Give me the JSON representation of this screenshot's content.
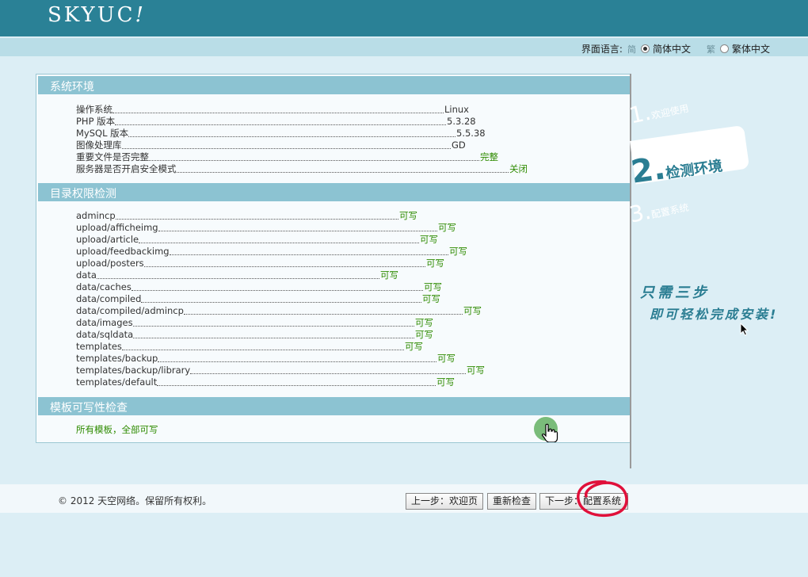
{
  "header": {
    "logo": "SKYUC",
    "logo_mark": "!"
  },
  "language": {
    "label": "界面语言:",
    "simplified_icon": "简",
    "simplified": "简体中文",
    "traditional_icon": "繁",
    "traditional": "繁体中文",
    "selected": "简体中文"
  },
  "env": {
    "title": "系统环境",
    "rows": [
      {
        "label": "操作系统",
        "value": "Linux"
      },
      {
        "label": "PHP 版本",
        "value": "5.3.28"
      },
      {
        "label": "MySQL 版本",
        "value": "5.5.38"
      },
      {
        "label": "图像处理库",
        "value": "GD"
      },
      {
        "label": "重要文件是否完整",
        "value": "完整"
      },
      {
        "label": "服务器是否开启安全模式",
        "value": "关闭"
      }
    ]
  },
  "dirs": {
    "title": "目录权限检测",
    "rows": [
      {
        "label": "admincp",
        "value": "可写"
      },
      {
        "label": "upload/afficheimg",
        "value": "可写"
      },
      {
        "label": "upload/article",
        "value": "可写"
      },
      {
        "label": "upload/feedbackimg",
        "value": "可写"
      },
      {
        "label": "upload/posters",
        "value": "可写"
      },
      {
        "label": "data",
        "value": "可写"
      },
      {
        "label": "data/caches",
        "value": "可写"
      },
      {
        "label": "data/compiled",
        "value": "可写"
      },
      {
        "label": "data/compiled/admincp",
        "value": "可写"
      },
      {
        "label": "data/images",
        "value": "可写"
      },
      {
        "label": "data/sqldata",
        "value": "可写"
      },
      {
        "label": "templates",
        "value": "可写"
      },
      {
        "label": "templates/backup",
        "value": "可写"
      },
      {
        "label": "templates/backup/library",
        "value": "可写"
      },
      {
        "label": "templates/default",
        "value": "可写"
      }
    ]
  },
  "templates_check": {
    "title": "模板可写性检查",
    "result": "所有模板，全部可写"
  },
  "steps": {
    "step1_num": "1.",
    "step1": "欢迎使用",
    "step2_num": "2.",
    "step2": "检测环境",
    "step3_num": "3.",
    "step3": "配置系统",
    "slogan1": "只需三步",
    "slogan2": "即可轻松完成安装!"
  },
  "footer": {
    "copyright": "© 2012 天空网络。保留所有权利。",
    "prev": "上一步：欢迎页",
    "recheck": "重新检查",
    "next": "下一步：配置系统"
  },
  "colors": {
    "header": "#2a8196",
    "section": "#8cc3d2",
    "ok": "#2e8b00",
    "annotation": "#e0103a"
  }
}
